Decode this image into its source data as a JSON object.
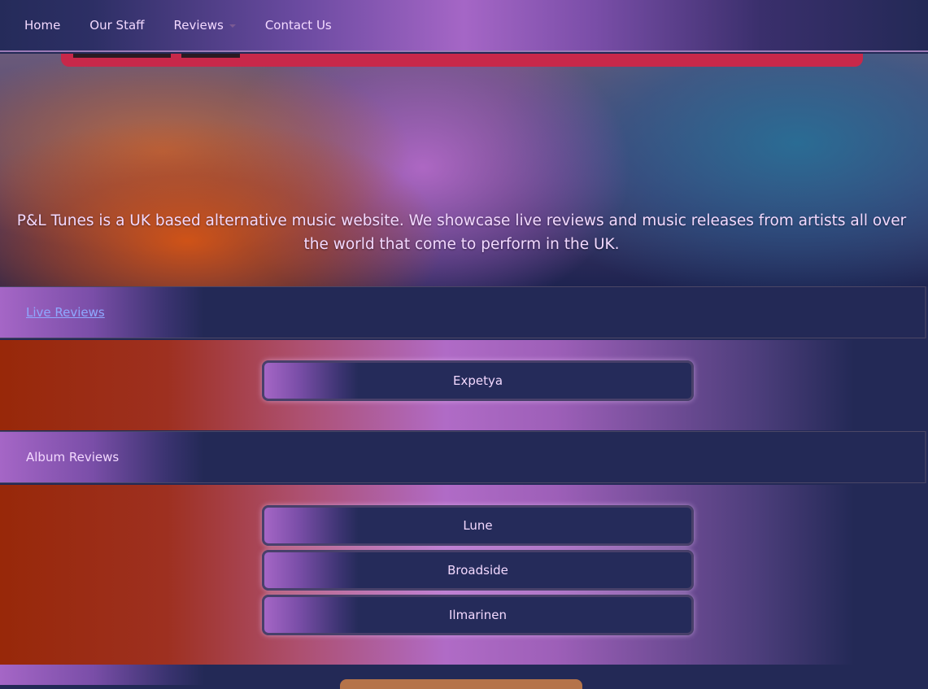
{
  "nav": {
    "home": "Home",
    "staff": "Our Staff",
    "reviews": "Reviews",
    "contact": "Contact Us"
  },
  "hero": {
    "text": "P&L Tunes is a UK based alternative music website. We showcase live reviews and music releases from artists all over the world that come to perform in the UK."
  },
  "live_reviews": {
    "title": "Live Reviews",
    "items": [
      "Expetya"
    ]
  },
  "album_reviews": {
    "title": "Album Reviews",
    "items": [
      "Lune",
      "Broadside",
      "Ilmarinen"
    ]
  },
  "colors": {
    "text": "#f3d9ff",
    "link": "#8fa8ff",
    "navy": "#232956",
    "purple": "#a566c6",
    "rust": "#982809"
  },
  "icons": {
    "reviews_dropdown": "caret-down-icon"
  }
}
